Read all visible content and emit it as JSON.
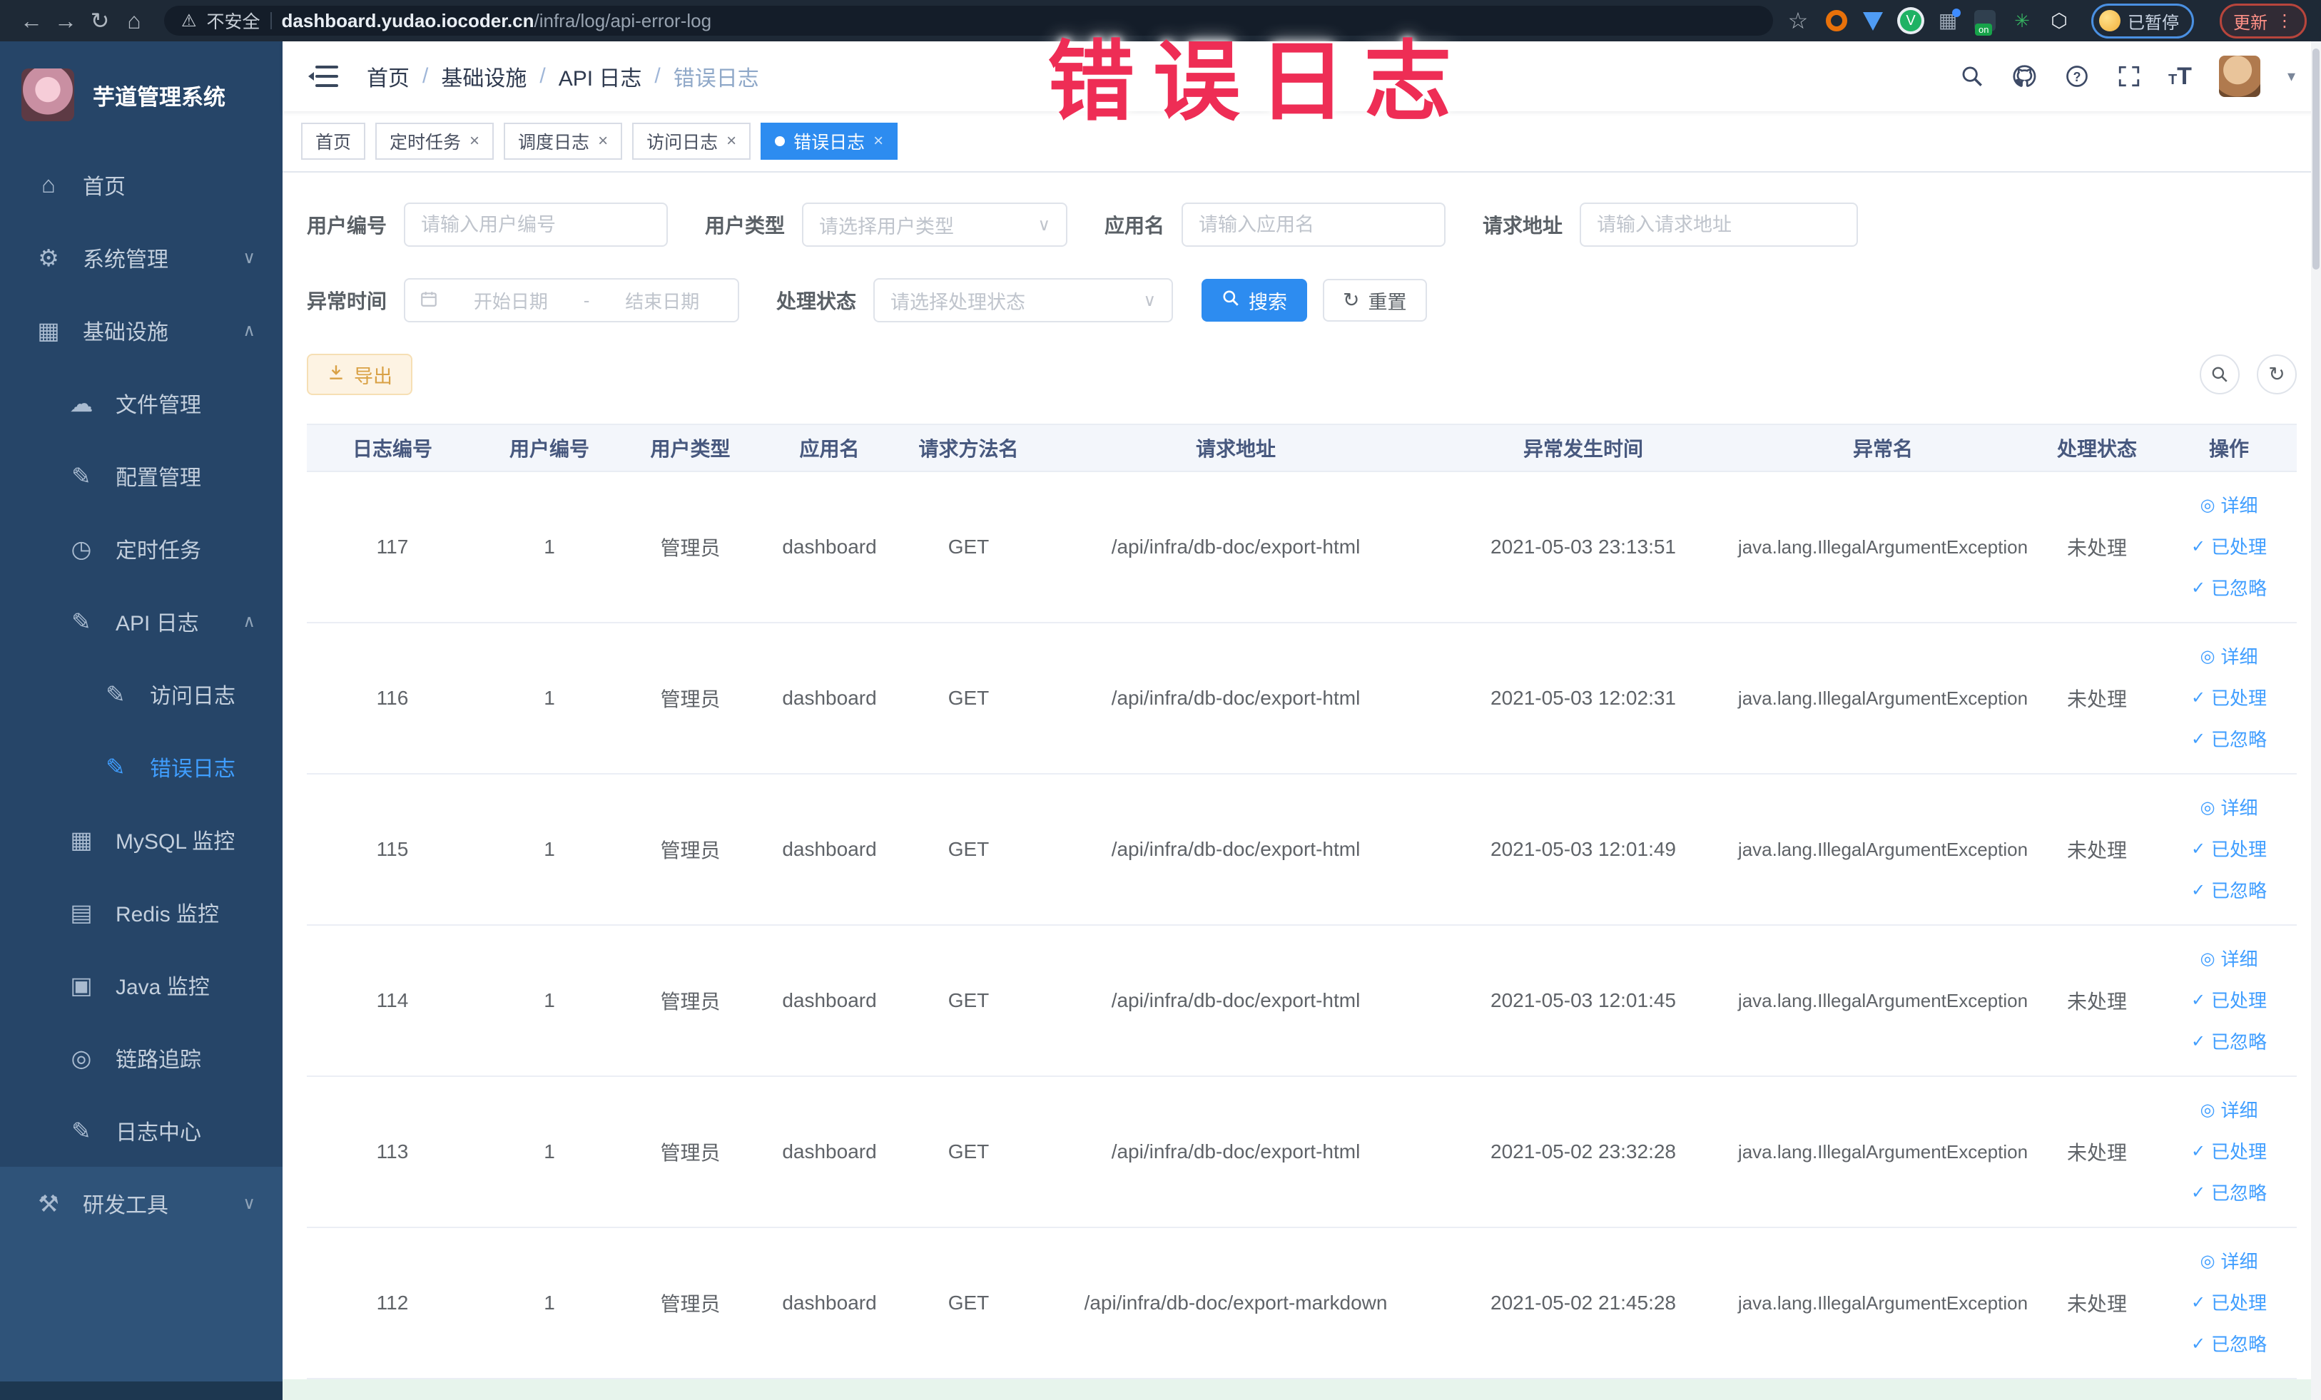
{
  "browser": {
    "warning": "不安全",
    "url_host": "dashboard.yudao.iocoder.cn",
    "url_path": "/infra/log/api-error-log",
    "profile_label": "已暂停",
    "update_label": "更新"
  },
  "annotation": "错误日志",
  "sidebar": {
    "title": "芋道管理系统",
    "menu": [
      {
        "label": "首页",
        "icon": "home-icon",
        "indent": 0,
        "chevron": null,
        "active": false,
        "section": "dark"
      },
      {
        "label": "系统管理",
        "icon": "gear-icon",
        "indent": 0,
        "chevron": "down",
        "active": false,
        "section": "dark"
      },
      {
        "label": "基础设施",
        "icon": "infra-icon",
        "indent": 0,
        "chevron": "up",
        "active": false,
        "section": "dark"
      },
      {
        "label": "文件管理",
        "icon": "cloud-upload-icon",
        "indent": 1,
        "chevron": null,
        "active": false,
        "section": "dark"
      },
      {
        "label": "配置管理",
        "icon": "edit-icon",
        "indent": 1,
        "chevron": null,
        "active": false,
        "section": "dark"
      },
      {
        "label": "定时任务",
        "icon": "timer-icon",
        "indent": 1,
        "chevron": null,
        "active": false,
        "section": "dark"
      },
      {
        "label": "API 日志",
        "icon": "edit-icon",
        "indent": 1,
        "chevron": "up",
        "active": false,
        "section": "dark"
      },
      {
        "label": "访问日志",
        "icon": "edit-icon",
        "indent": 2,
        "chevron": null,
        "active": false,
        "section": "dark"
      },
      {
        "label": "错误日志",
        "icon": "edit-icon",
        "indent": 2,
        "chevron": null,
        "active": true,
        "section": "dark"
      },
      {
        "label": "MySQL 监控",
        "icon": "chart-icon",
        "indent": 1,
        "chevron": null,
        "active": false,
        "section": "dark"
      },
      {
        "label": "Redis 监控",
        "icon": "layers-icon",
        "indent": 1,
        "chevron": null,
        "active": false,
        "section": "dark"
      },
      {
        "label": "Java 监控",
        "icon": "monitor-icon",
        "indent": 1,
        "chevron": null,
        "active": false,
        "section": "dark"
      },
      {
        "label": "链路追踪",
        "icon": "eye-icon",
        "indent": 1,
        "chevron": null,
        "active": false,
        "section": "dark"
      },
      {
        "label": "日志中心",
        "icon": "edit-icon",
        "indent": 1,
        "chevron": null,
        "active": false,
        "section": "dark"
      },
      {
        "label": "研发工具",
        "icon": "tools-icon",
        "indent": 0,
        "chevron": "down",
        "active": false,
        "section": "light"
      }
    ]
  },
  "navbar": {
    "breadcrumb": [
      "首页",
      "基础设施",
      "API 日志",
      "错误日志"
    ]
  },
  "tabs": [
    {
      "label": "首页",
      "closable": false,
      "active": false
    },
    {
      "label": "定时任务",
      "closable": true,
      "active": false
    },
    {
      "label": "调度日志",
      "closable": true,
      "active": false
    },
    {
      "label": "访问日志",
      "closable": true,
      "active": false
    },
    {
      "label": "错误日志",
      "closable": true,
      "active": true
    }
  ],
  "filters": {
    "user_id": {
      "label": "用户编号",
      "placeholder": "请输入用户编号"
    },
    "user_type": {
      "label": "用户类型",
      "placeholder": "请选择用户类型"
    },
    "app_name": {
      "label": "应用名",
      "placeholder": "请输入应用名"
    },
    "request_url": {
      "label": "请求地址",
      "placeholder": "请输入请求地址"
    },
    "exception_time": {
      "label": "异常时间",
      "start_placeholder": "开始日期",
      "separator": "-",
      "end_placeholder": "结束日期"
    },
    "process_status": {
      "label": "处理状态",
      "placeholder": "请选择处理状态"
    },
    "search_button": "搜索",
    "reset_button": "重置"
  },
  "toolbar": {
    "export_button": "导出"
  },
  "table": {
    "columns": [
      "日志编号",
      "用户编号",
      "用户类型",
      "应用名",
      "请求方法名",
      "请求地址",
      "异常发生时间",
      "异常名",
      "处理状态",
      "操作"
    ],
    "actions": [
      "详细",
      "已处理",
      "已忽略"
    ],
    "rows": [
      {
        "id": "117",
        "user_id": "1",
        "user_type": "管理员",
        "app": "dashboard",
        "method": "GET",
        "url": "/api/infra/db-doc/export-html",
        "time": "2021-05-03 23:13:51",
        "exception": "java.lang.IllegalArgumentException",
        "status": "未处理"
      },
      {
        "id": "116",
        "user_id": "1",
        "user_type": "管理员",
        "app": "dashboard",
        "method": "GET",
        "url": "/api/infra/db-doc/export-html",
        "time": "2021-05-03 12:02:31",
        "exception": "java.lang.IllegalArgumentException",
        "status": "未处理"
      },
      {
        "id": "115",
        "user_id": "1",
        "user_type": "管理员",
        "app": "dashboard",
        "method": "GET",
        "url": "/api/infra/db-doc/export-html",
        "time": "2021-05-03 12:01:49",
        "exception": "java.lang.IllegalArgumentException",
        "status": "未处理"
      },
      {
        "id": "114",
        "user_id": "1",
        "user_type": "管理员",
        "app": "dashboard",
        "method": "GET",
        "url": "/api/infra/db-doc/export-html",
        "time": "2021-05-03 12:01:45",
        "exception": "java.lang.IllegalArgumentException",
        "status": "未处理"
      },
      {
        "id": "113",
        "user_id": "1",
        "user_type": "管理员",
        "app": "dashboard",
        "method": "GET",
        "url": "/api/infra/db-doc/export-html",
        "time": "2021-05-02 23:32:28",
        "exception": "java.lang.IllegalArgumentException",
        "status": "未处理"
      },
      {
        "id": "112",
        "user_id": "1",
        "user_type": "管理员",
        "app": "dashboard",
        "method": "GET",
        "url": "/api/infra/db-doc/export-markdown",
        "time": "2021-05-02 21:45:28",
        "exception": "java.lang.IllegalArgumentException",
        "status": "未处理"
      }
    ]
  }
}
